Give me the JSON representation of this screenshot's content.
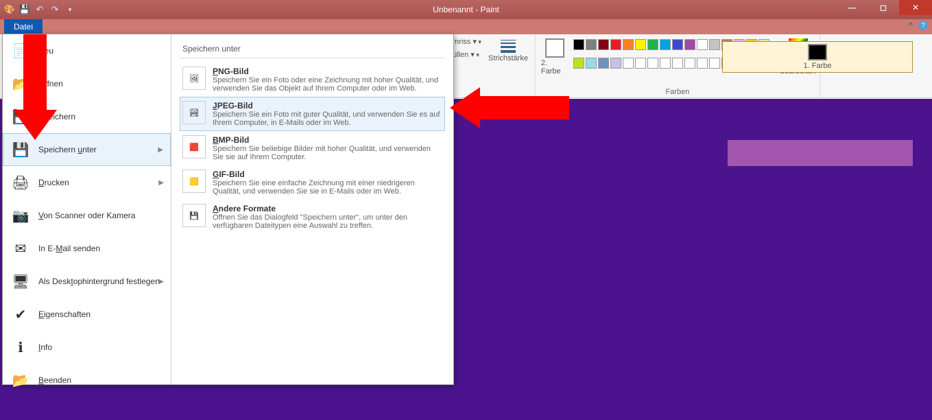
{
  "title": "Unbenannt - Paint",
  "file_tab": "Datei",
  "ribbon": {
    "truncated1": "mriss ▾",
    "truncated2": "üllen ▾",
    "size": "Strichstärke",
    "color1": "1. Farbe",
    "color2": "2. Farbe",
    "colors_group": "Farben",
    "edit_colors": "Palette bearbeiten",
    "palette": [
      "#000000",
      "#7f7f7f",
      "#880015",
      "#ed1c24",
      "#ff7f27",
      "#fff200",
      "#22b14c",
      "#00a2e8",
      "#3f48cc",
      "#a349a4",
      "#ffffff",
      "#c3c3c3",
      "#b97a57",
      "#ffaec9",
      "#ffc90e",
      "#efe4b0",
      "#b5e61d",
      "#99d9ea",
      "#7092be",
      "#c8bfe7",
      "#ffffff",
      "#ffffff",
      "#ffffff",
      "#ffffff",
      "#ffffff",
      "#ffffff",
      "#ffffff",
      "#ffffff",
      "#ffffff",
      "#ffffff"
    ]
  },
  "menu": {
    "items": [
      {
        "label": "Neu",
        "icon": "📄"
      },
      {
        "label": "Öffnen",
        "icon": "📂"
      },
      {
        "label": "Speichern",
        "icon": "💾"
      },
      {
        "label": "Speichern unter",
        "icon": "💾",
        "arrow": true,
        "hover": true,
        "ukey": "u"
      },
      {
        "label": "Drucken",
        "icon": "🖨",
        "arrow": true,
        "ukey": "D"
      },
      {
        "label": "Von Scanner oder Kamera",
        "icon": "📷",
        "ukey": "V"
      },
      {
        "label": "In E-Mail senden",
        "icon": "✉",
        "ukey": "M"
      },
      {
        "label": "Als Desktophintergrund festlegen",
        "icon": "🖥",
        "arrow": true,
        "ukey": "t"
      },
      {
        "label": "Eigenschaften",
        "icon": "✔",
        "ukey": "E"
      },
      {
        "label": "Info",
        "icon": "ℹ",
        "ukey": "I"
      },
      {
        "label": "Beenden",
        "icon": "📂",
        "ukey": "B"
      }
    ],
    "sub_head": "Speichern unter",
    "formats": [
      {
        "title": "PNG-Bild",
        "ukey": "P",
        "desc": "Speichern Sie ein Foto oder eine Zeichnung mit hoher Qualität, und verwenden Sie das Objekt auf Ihrem Computer oder im Web.",
        "icon": "🖼"
      },
      {
        "title": "JPEG-Bild",
        "ukey": "J",
        "desc": "Speichern Sie ein Foto mit guter Qualität, und verwenden Sie es auf Ihrem Computer, in E-Mails oder im Web.",
        "icon": "🏞",
        "hover": true
      },
      {
        "title": "BMP-Bild",
        "ukey": "B",
        "desc": "Speichern Sie beliebige Bilder mit hoher Qualität, und verwenden Sie sie auf Ihrem Computer.",
        "icon": "🟥"
      },
      {
        "title": "GIF-Bild",
        "ukey": "G",
        "desc": "Speichern Sie eine einfache Zeichnung mit einer niedrigeren Qualität, und verwenden Sie sie in E-Mails oder im Web.",
        "icon": "🟨"
      },
      {
        "title": "Andere Formate",
        "ukey": "A",
        "desc": "Öffnen Sie das Dialogfeld \"Speichern unter\", um unter den verfügbaren Dateitypen eine Auswahl zu treffen.",
        "icon": "💾"
      }
    ]
  }
}
